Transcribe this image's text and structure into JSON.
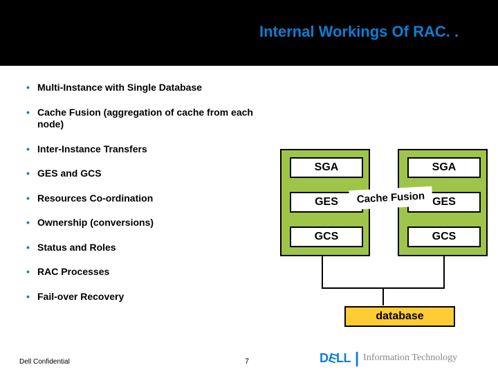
{
  "title": "Internal Workings Of RAC. .",
  "bullets": [
    "Multi-Instance with Single Database",
    "Cache Fusion (aggregation of cache from each node)",
    "Inter-Instance Transfers",
    "GES and GCS",
    "Resources Co-ordination",
    "Ownership (conversions)",
    "Status and Roles",
    "RAC Processes",
    "Fail-over Recovery"
  ],
  "diagram": {
    "node_left": {
      "sga": "SGA",
      "ges": "GES",
      "gcs": "GCS"
    },
    "node_right": {
      "sga": "SGA",
      "ges": "GES",
      "gcs": "GCS"
    },
    "cache_fusion_label": "Cache Fusion",
    "database_label": "database"
  },
  "footer": {
    "confidential": "Dell Confidential",
    "page": "7",
    "logo_dell": "D",
    "logo_dell_e": "E",
    "logo_dell_rest": "LL",
    "logo_sep": "|",
    "logo_it": "Information Technology"
  }
}
